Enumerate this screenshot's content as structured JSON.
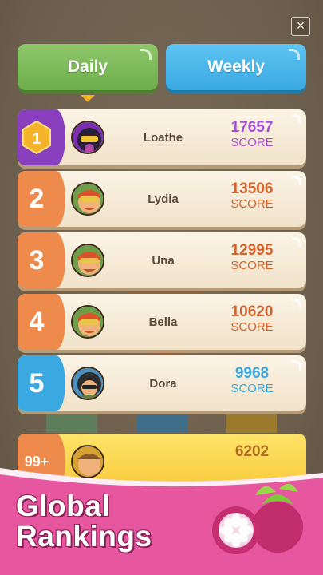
{
  "close_icon": "×",
  "tabs": {
    "daily": "Daily",
    "weekly": "Weekly",
    "active": "daily"
  },
  "rows": [
    {
      "rank": "1",
      "name": "Loathe",
      "score": "17657",
      "score_label": "SCORE",
      "color": "#a84fd4",
      "rank_color": "#8a3fbf",
      "avatar": "purple-helmet"
    },
    {
      "rank": "2",
      "name": "Lydia",
      "score": "13506",
      "score_label": "SCORE",
      "color": "#d5612a",
      "rank_color": "#ee8a4c",
      "avatar": "orange-goggles"
    },
    {
      "rank": "3",
      "name": "Una",
      "score": "12995",
      "score_label": "SCORE",
      "color": "#d5612a",
      "rank_color": "#ee8a4c",
      "avatar": "orange-goggles"
    },
    {
      "rank": "4",
      "name": "Bella",
      "score": "10620",
      "score_label": "SCORE",
      "color": "#d5612a",
      "rank_color": "#ee8a4c",
      "avatar": "orange-goggles"
    },
    {
      "rank": "5",
      "name": "Dora",
      "score": "9968",
      "score_label": "SCORE",
      "color": "#3aa9e2",
      "rank_color": "#3aa9e2",
      "avatar": "dark-hair"
    }
  ],
  "my_row": {
    "rank": "99+",
    "score": "6202"
  },
  "promo": {
    "title": "Global\nRankings"
  }
}
